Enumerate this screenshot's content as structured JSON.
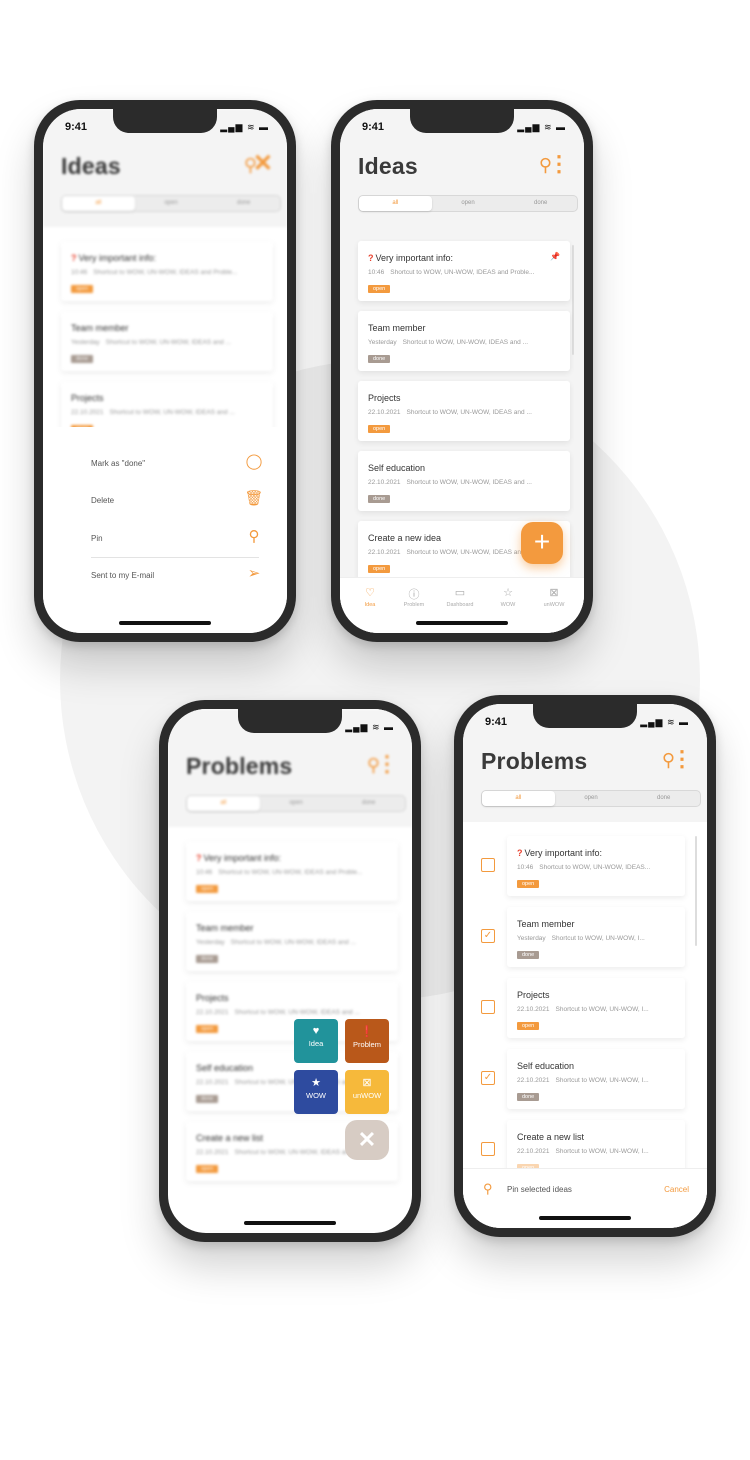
{
  "colors": {
    "accent": "#f39a3e",
    "done_tag": "#a89b92",
    "idea": "#21939b",
    "problem": "#b9581a",
    "wow": "#2e4b9f",
    "unwow": "#f6b93b"
  },
  "status": {
    "time": "9:41",
    "icons": "▂▄▆ ≋ ▬"
  },
  "segment": {
    "all": "all",
    "open": "open",
    "done": "done"
  },
  "tabs": {
    "idea": "Idea",
    "problem": "Problem",
    "dashboard": "Dashboard",
    "wow": "WOW",
    "unwow": "unWOW"
  },
  "ideas_cards": [
    {
      "title": "Very important info:",
      "date": "10:46",
      "text": "Shortcut to WOW, UN-WOW, IDEAS and Proble...",
      "tag": "open"
    },
    {
      "title": "Team member",
      "date": "Yesterday",
      "text": "Shortcut to WOW, UN-WOW, IDEAS and ...",
      "tag": "done"
    },
    {
      "title": "Projects",
      "date": "22.10.2021",
      "text": "Shortcut to WOW, UN-WOW, IDEAS and ...",
      "tag": "open"
    },
    {
      "title": "Self education",
      "date": "22.10.2021",
      "text": "Shortcut to WOW, UN-WOW, IDEAS and ...",
      "tag": "done"
    },
    {
      "title": "Create a new idea",
      "date": "22.10.2021",
      "text": "Shortcut to WOW, UN-WOW, IDEAS and ...",
      "tag": "open"
    }
  ],
  "problems_cards": [
    {
      "title": "Very important info:",
      "date": "10:46",
      "text": "Shortcut to WOW, UN-WOW, IDEAS and Proble...",
      "tag": "open"
    },
    {
      "title": "Team member",
      "date": "Yesterday",
      "text": "Shortcut to WOW, UN-WOW, IDEAS and ...",
      "tag": "done"
    },
    {
      "title": "Projects",
      "date": "22.10.2021",
      "text": "Shortcut to WOW, UN-WOW, IDEAS and ...",
      "tag": "open"
    },
    {
      "title": "Self education",
      "date": "22.10.2021",
      "text": "Shortcut to WOW, UN-WOW, IDEAS and ...",
      "tag": "done"
    },
    {
      "title": "Create a new list",
      "date": "22.10.2021",
      "text": "Shortcut to WOW, UN-WOW, IDEAS and ...",
      "tag": "open"
    }
  ],
  "select_cards": [
    {
      "title": "Very important info:",
      "date": "10:46",
      "text": "Shortcut to WOW, UN-WOW, IDEAS...",
      "tag": "open",
      "checked": false
    },
    {
      "title": "Team member",
      "date": "Yesterday",
      "text": "Shortcut to WOW, UN-WOW, I...",
      "tag": "done",
      "checked": true
    },
    {
      "title": "Projects",
      "date": "22.10.2021",
      "text": "Shortcut to WOW, UN-WOW, I...",
      "tag": "open",
      "checked": false
    },
    {
      "title": "Self education",
      "date": "22.10.2021",
      "text": "Shortcut to WOW, UN-WOW, I...",
      "tag": "done",
      "checked": true
    },
    {
      "title": "Create a new list",
      "date": "22.10.2021",
      "text": "Shortcut to WOW, UN-WOW, I...",
      "tag": "open",
      "checked": false
    }
  ],
  "phone1": {
    "title": "Ideas",
    "sheet": {
      "mark_done": "Mark as \"done\"",
      "delete": "Delete",
      "pin": "Pin",
      "send": "Sent to my E-mail"
    }
  },
  "phone2": {
    "title": "Ideas",
    "fab": "+"
  },
  "phone3": {
    "title": "Problems",
    "speed": {
      "idea": "Idea",
      "problem": "Problem",
      "wow": "WOW",
      "unwow": "unWOW",
      "close": "✕"
    }
  },
  "phone4": {
    "title": "Problems",
    "pin_selected": "Pin selected ideas",
    "cancel": "Cancel"
  }
}
